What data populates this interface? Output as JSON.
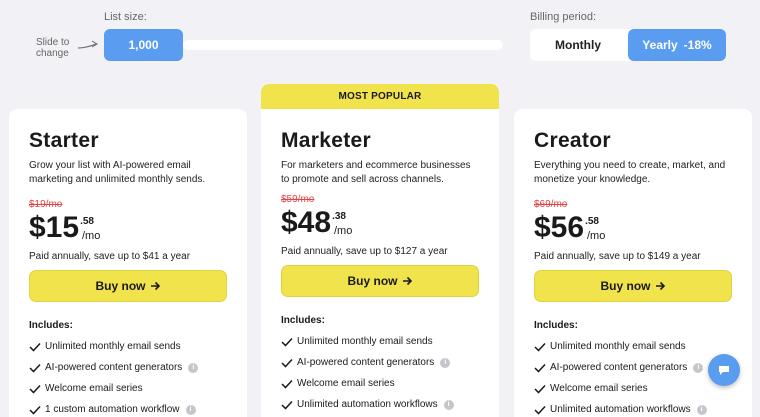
{
  "list_size": {
    "label": "List size:",
    "value": "1,000",
    "hint": "Slide to change"
  },
  "billing": {
    "label": "Billing period:",
    "monthly": "Monthly",
    "yearly": "Yearly",
    "discount": "-18%"
  },
  "badge": "MOST POPULAR",
  "plans": [
    {
      "name": "Starter",
      "description": "Grow your list with AI-powered email marketing and unlimited monthly sends.",
      "old_price": "$19/mo",
      "price": "$15",
      "cents": ".58",
      "per": "/mo",
      "save": "Paid annually, save up to $41 a year",
      "cta": "Buy now",
      "includes": "Includes:",
      "features": [
        "Unlimited monthly email sends",
        "AI-powered content generators",
        "Welcome email series",
        "1 custom automation workflow"
      ]
    },
    {
      "name": "Marketer",
      "description": "For marketers and ecommerce businesses to promote and sell across channels.",
      "old_price": "$59/mo",
      "price": "$48",
      "cents": ".38",
      "per": "/mo",
      "save": "Paid annually, save up to $127 a year",
      "cta": "Buy now",
      "includes": "Includes:",
      "features": [
        "Unlimited monthly email sends",
        "AI-powered content generators",
        "Welcome email series",
        "Unlimited automation workflows"
      ]
    },
    {
      "name": "Creator",
      "description": "Everything you need to create, market, and monetize your knowledge.",
      "old_price": "$69/mo",
      "price": "$56",
      "cents": ".58",
      "per": "/mo",
      "save": "Paid annually, save up to $149 a year",
      "cta": "Buy now",
      "includes": "Includes:",
      "features": [
        "Unlimited monthly email sends",
        "AI-powered content generators",
        "Welcome email series",
        "Unlimited automation workflows"
      ]
    }
  ],
  "colors": {
    "accent_blue": "#5a9cf0",
    "button_yellow": "#f1e34c",
    "strike_red": "#e04545"
  },
  "icons": {
    "check": "check-icon",
    "info": "info-icon",
    "arrow": "arrow-right-icon",
    "chat": "chat-icon"
  }
}
